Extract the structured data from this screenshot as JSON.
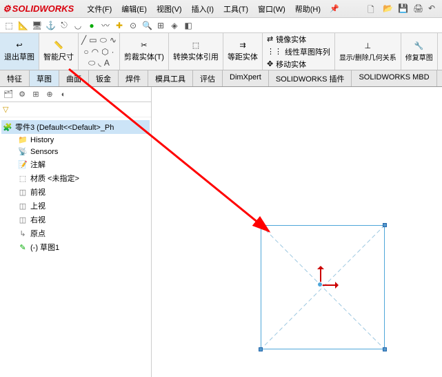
{
  "app": {
    "name": "SOLIDWORKS"
  },
  "menu": {
    "file": "文件(F)",
    "edit": "编辑(E)",
    "view": "视图(V)",
    "insert": "插入(I)",
    "tools": "工具(T)",
    "window": "窗口(W)",
    "help": "帮助(H)"
  },
  "ribbon": {
    "exit_sketch": "退出草图",
    "smart_dim": "智能尺寸",
    "trim": "剪裁实体(T)",
    "convert": "转换实体引用",
    "offset": "等距实体",
    "mirror": "镜像实体",
    "pattern": "线性草图阵列",
    "move": "移动实体",
    "display_delete": "显示/删除几何关系",
    "repair": "修复草图"
  },
  "tabs": {
    "feature": "特征",
    "sketch": "草图",
    "surface": "曲面",
    "sheet": "钣金",
    "weld": "焊件",
    "mold": "模具工具",
    "evaluate": "评估",
    "dimxpert": "DimXpert",
    "plugins": "SOLIDWORKS 插件",
    "mbd": "SOLIDWORKS MBD"
  },
  "tree": {
    "root": "零件3 (Default<<Default>_Ph",
    "history": "History",
    "sensors": "Sensors",
    "annotations": "注解",
    "material": "材质 <未指定>",
    "front": "前视",
    "top": "上视",
    "right": "右视",
    "origin": "原点",
    "sketch1": "(-) 草图1"
  }
}
